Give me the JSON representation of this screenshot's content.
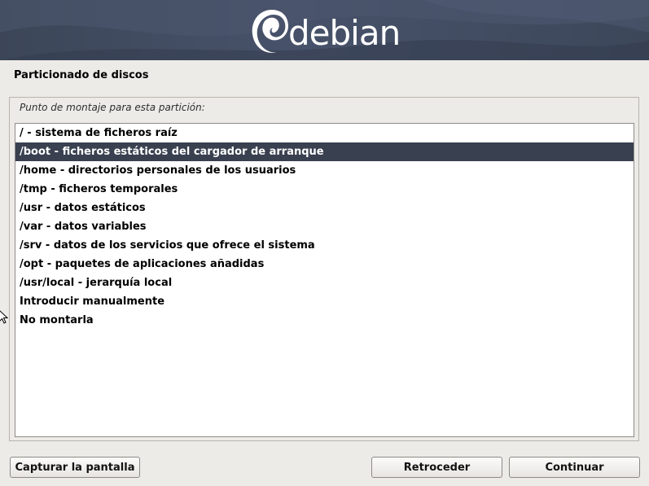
{
  "banner": {
    "brand": "debian",
    "logo_icon": "debian-swirl-icon"
  },
  "page_title": "Particionado de discos",
  "prompt": "Punto de montaje para esta partición:",
  "list": {
    "selected_index": 1,
    "items": [
      "/ - sistema de ficheros raíz",
      "/boot - ficheros estáticos del cargador de arranque",
      "/home - directorios personales de los usuarios",
      "/tmp - ficheros temporales",
      "/usr - datos estáticos",
      "/var - datos variables",
      "/srv - datos de los servicios que ofrece el sistema",
      "/opt - paquetes de aplicaciones añadidas",
      "/usr/local - jerarquía local",
      "Introducir manualmente",
      "No montarla"
    ]
  },
  "buttons": {
    "screenshot": "Capturar la pantalla",
    "back": "Retroceder",
    "continue": "Continuar"
  },
  "colors": {
    "banner": "#47526a",
    "selection": "#39404f",
    "background": "#edebe7"
  }
}
